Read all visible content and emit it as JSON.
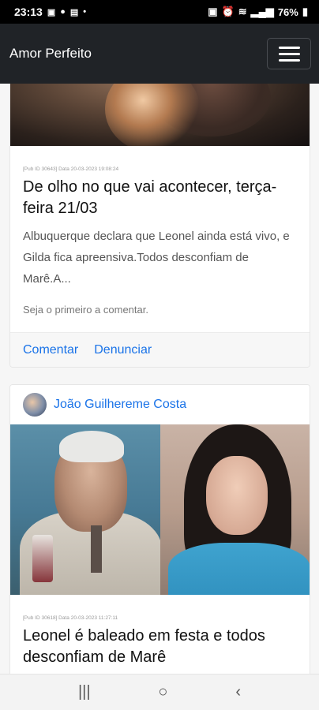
{
  "status_bar": {
    "time": "23:13",
    "left_icons": [
      "image-icon",
      "facebook-icon",
      "cast-icon",
      "dot-icon"
    ],
    "battery": "76%",
    "right_icons": [
      "lock-icon",
      "alarm-icon",
      "wifi-icon",
      "signal-icon",
      "battery-icon"
    ]
  },
  "navbar": {
    "brand": "Amor Perfeito",
    "menu_icon": "hamburger-icon"
  },
  "cards": [
    {
      "meta": "[Pub ID 30643] Data 20-03-2023 19:08:24",
      "title": "De olho no que vai acontecer, terça-feira 21/03",
      "excerpt": "Albuquerque declara que Leonel ainda está vivo, e Gilda fica apreensiva.Todos desconfiam de Marê.A...",
      "comments_note": "Seja o primeiro a comentar.",
      "actions": {
        "comment": "Comentar",
        "report": "Denunciar"
      }
    },
    {
      "author": "João Guilhereme Costa",
      "meta": "[Pub ID 30618] Data 20-03-2023 11:27:11",
      "title": "Leonel é baleado em festa e todos desconfiam de Marê"
    }
  ],
  "system_nav": {
    "recents": "|||",
    "home": "○",
    "back": "‹"
  }
}
